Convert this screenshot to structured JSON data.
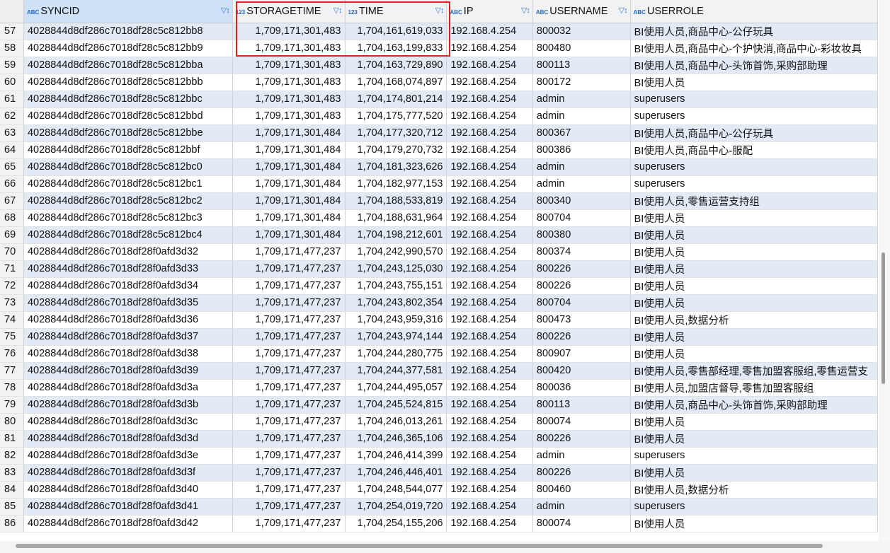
{
  "columns": [
    {
      "name": "SYNCID",
      "type": "ABC"
    },
    {
      "name": "STORAGETIME",
      "type": "123"
    },
    {
      "name": "TIME",
      "type": "123"
    },
    {
      "name": "IP",
      "type": "ABC"
    },
    {
      "name": "USERNAME",
      "type": "ABC"
    },
    {
      "name": "USERROLE",
      "type": "ABC"
    }
  ],
  "rows": [
    {
      "n": "57",
      "syncid": "4028844d8df286c7018df28c5c812bb8",
      "storagetime": "1,709,171,301,483",
      "time": "1,704,161,619,033",
      "ip": "192.168.4.254",
      "username": "800032",
      "userrole": "BI使用人员,商品中心-公仔玩具"
    },
    {
      "n": "58",
      "syncid": "4028844d8df286c7018df28c5c812bb9",
      "storagetime": "1,709,171,301,483",
      "time": "1,704,163,199,833",
      "ip": "192.168.4.254",
      "username": "800480",
      "userrole": "BI使用人员,商品中心-个护快消,商品中心-彩妆妆具"
    },
    {
      "n": "59",
      "syncid": "4028844d8df286c7018df28c5c812bba",
      "storagetime": "1,709,171,301,483",
      "time": "1,704,163,729,890",
      "ip": "192.168.4.254",
      "username": "800113",
      "userrole": "BI使用人员,商品中心-头饰首饰,采购部助理"
    },
    {
      "n": "60",
      "syncid": "4028844d8df286c7018df28c5c812bbb",
      "storagetime": "1,709,171,301,483",
      "time": "1,704,168,074,897",
      "ip": "192.168.4.254",
      "username": "800172",
      "userrole": "BI使用人员"
    },
    {
      "n": "61",
      "syncid": "4028844d8df286c7018df28c5c812bbc",
      "storagetime": "1,709,171,301,483",
      "time": "1,704,174,801,214",
      "ip": "192.168.4.254",
      "username": "admin",
      "userrole": "superusers"
    },
    {
      "n": "62",
      "syncid": "4028844d8df286c7018df28c5c812bbd",
      "storagetime": "1,709,171,301,483",
      "time": "1,704,175,777,520",
      "ip": "192.168.4.254",
      "username": "admin",
      "userrole": "superusers"
    },
    {
      "n": "63",
      "syncid": "4028844d8df286c7018df28c5c812bbe",
      "storagetime": "1,709,171,301,484",
      "time": "1,704,177,320,712",
      "ip": "192.168.4.254",
      "username": "800367",
      "userrole": "BI使用人员,商品中心-公仔玩具"
    },
    {
      "n": "64",
      "syncid": "4028844d8df286c7018df28c5c812bbf",
      "storagetime": "1,709,171,301,484",
      "time": "1,704,179,270,732",
      "ip": "192.168.4.254",
      "username": "800386",
      "userrole": "BI使用人员,商品中心-服配"
    },
    {
      "n": "65",
      "syncid": "4028844d8df286c7018df28c5c812bc0",
      "storagetime": "1,709,171,301,484",
      "time": "1,704,181,323,626",
      "ip": "192.168.4.254",
      "username": "admin",
      "userrole": "superusers"
    },
    {
      "n": "66",
      "syncid": "4028844d8df286c7018df28c5c812bc1",
      "storagetime": "1,709,171,301,484",
      "time": "1,704,182,977,153",
      "ip": "192.168.4.254",
      "username": "admin",
      "userrole": "superusers"
    },
    {
      "n": "67",
      "syncid": "4028844d8df286c7018df28c5c812bc2",
      "storagetime": "1,709,171,301,484",
      "time": "1,704,188,533,819",
      "ip": "192.168.4.254",
      "username": "800340",
      "userrole": "BI使用人员,零售运营支持组"
    },
    {
      "n": "68",
      "syncid": "4028844d8df286c7018df28c5c812bc3",
      "storagetime": "1,709,171,301,484",
      "time": "1,704,188,631,964",
      "ip": "192.168.4.254",
      "username": "800704",
      "userrole": "BI使用人员"
    },
    {
      "n": "69",
      "syncid": "4028844d8df286c7018df28c5c812bc4",
      "storagetime": "1,709,171,301,484",
      "time": "1,704,198,212,601",
      "ip": "192.168.4.254",
      "username": "800380",
      "userrole": "BI使用人员"
    },
    {
      "n": "70",
      "syncid": "4028844d8df286c7018df28f0afd3d32",
      "storagetime": "1,709,171,477,237",
      "time": "1,704,242,990,570",
      "ip": "192.168.4.254",
      "username": "800374",
      "userrole": "BI使用人员"
    },
    {
      "n": "71",
      "syncid": "4028844d8df286c7018df28f0afd3d33",
      "storagetime": "1,709,171,477,237",
      "time": "1,704,243,125,030",
      "ip": "192.168.4.254",
      "username": "800226",
      "userrole": "BI使用人员"
    },
    {
      "n": "72",
      "syncid": "4028844d8df286c7018df28f0afd3d34",
      "storagetime": "1,709,171,477,237",
      "time": "1,704,243,755,151",
      "ip": "192.168.4.254",
      "username": "800226",
      "userrole": "BI使用人员"
    },
    {
      "n": "73",
      "syncid": "4028844d8df286c7018df28f0afd3d35",
      "storagetime": "1,709,171,477,237",
      "time": "1,704,243,802,354",
      "ip": "192.168.4.254",
      "username": "800704",
      "userrole": "BI使用人员"
    },
    {
      "n": "74",
      "syncid": "4028844d8df286c7018df28f0afd3d36",
      "storagetime": "1,709,171,477,237",
      "time": "1,704,243,959,316",
      "ip": "192.168.4.254",
      "username": "800473",
      "userrole": "BI使用人员,数据分析"
    },
    {
      "n": "75",
      "syncid": "4028844d8df286c7018df28f0afd3d37",
      "storagetime": "1,709,171,477,237",
      "time": "1,704,243,974,144",
      "ip": "192.168.4.254",
      "username": "800226",
      "userrole": "BI使用人员"
    },
    {
      "n": "76",
      "syncid": "4028844d8df286c7018df28f0afd3d38",
      "storagetime": "1,709,171,477,237",
      "time": "1,704,244,280,775",
      "ip": "192.168.4.254",
      "username": "800907",
      "userrole": "BI使用人员"
    },
    {
      "n": "77",
      "syncid": "4028844d8df286c7018df28f0afd3d39",
      "storagetime": "1,709,171,477,237",
      "time": "1,704,244,377,581",
      "ip": "192.168.4.254",
      "username": "800420",
      "userrole": "BI使用人员,零售部经理,零售加盟客服组,零售运营支"
    },
    {
      "n": "78",
      "syncid": "4028844d8df286c7018df28f0afd3d3a",
      "storagetime": "1,709,171,477,237",
      "time": "1,704,244,495,057",
      "ip": "192.168.4.254",
      "username": "800036",
      "userrole": "BI使用人员,加盟店督导,零售加盟客服组"
    },
    {
      "n": "79",
      "syncid": "4028844d8df286c7018df28f0afd3d3b",
      "storagetime": "1,709,171,477,237",
      "time": "1,704,245,524,815",
      "ip": "192.168.4.254",
      "username": "800113",
      "userrole": "BI使用人员,商品中心-头饰首饰,采购部助理"
    },
    {
      "n": "80",
      "syncid": "4028844d8df286c7018df28f0afd3d3c",
      "storagetime": "1,709,171,477,237",
      "time": "1,704,246,013,261",
      "ip": "192.168.4.254",
      "username": "800074",
      "userrole": "BI使用人员"
    },
    {
      "n": "81",
      "syncid": "4028844d8df286c7018df28f0afd3d3d",
      "storagetime": "1,709,171,477,237",
      "time": "1,704,246,365,106",
      "ip": "192.168.4.254",
      "username": "800226",
      "userrole": "BI使用人员"
    },
    {
      "n": "82",
      "syncid": "4028844d8df286c7018df28f0afd3d3e",
      "storagetime": "1,709,171,477,237",
      "time": "1,704,246,414,399",
      "ip": "192.168.4.254",
      "username": "admin",
      "userrole": "superusers"
    },
    {
      "n": "83",
      "syncid": "4028844d8df286c7018df28f0afd3d3f",
      "storagetime": "1,709,171,477,237",
      "time": "1,704,246,446,401",
      "ip": "192.168.4.254",
      "username": "800226",
      "userrole": "BI使用人员"
    },
    {
      "n": "84",
      "syncid": "4028844d8df286c7018df28f0afd3d40",
      "storagetime": "1,709,171,477,237",
      "time": "1,704,248,544,077",
      "ip": "192.168.4.254",
      "username": "800460",
      "userrole": "BI使用人员,数据分析"
    },
    {
      "n": "85",
      "syncid": "4028844d8df286c7018df28f0afd3d41",
      "storagetime": "1,709,171,477,237",
      "time": "1,704,254,019,720",
      "ip": "192.168.4.254",
      "username": "admin",
      "userrole": "superusers"
    },
    {
      "n": "86",
      "syncid": "4028844d8df286c7018df28f0afd3d42",
      "storagetime": "1,709,171,477,237",
      "time": "1,704,254,155,206",
      "ip": "192.168.4.254",
      "username": "800074",
      "userrole": "BI使用人员"
    }
  ],
  "colors": {
    "row_alt": "#e2eaf6",
    "header_bg": "#f2f2f2",
    "highlight_box": "#e02020",
    "type_badge": "#2468c8"
  }
}
